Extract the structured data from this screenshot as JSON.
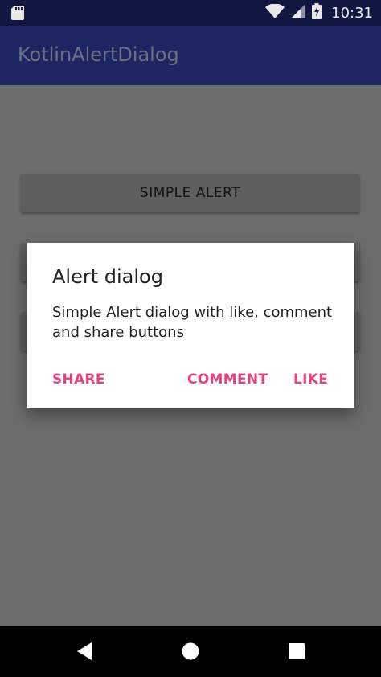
{
  "status_bar": {
    "time": "10:31",
    "icons": [
      "sd-card-icon",
      "wifi-icon",
      "signal-icon",
      "battery-charging-icon"
    ]
  },
  "app_bar": {
    "title": "KotlinAlertDialog"
  },
  "background_buttons": [
    {
      "label": "SIMPLE ALERT"
    },
    {
      "label": ""
    },
    {
      "label": ""
    }
  ],
  "dialog": {
    "title": "Alert dialog",
    "message": "Simple Alert dialog with like, comment and share buttons",
    "actions": {
      "share": "SHARE",
      "comment": "COMMENT",
      "like": "LIKE"
    },
    "accent_color": "#e6407f"
  },
  "nav_bar": {
    "icons": [
      "back-icon",
      "home-icon",
      "recents-icon"
    ]
  },
  "colors": {
    "status_bar": "#111740",
    "app_bar": "#1d2563",
    "scrim_background": "#6d6d6d",
    "dialog_background": "#ffffff"
  }
}
